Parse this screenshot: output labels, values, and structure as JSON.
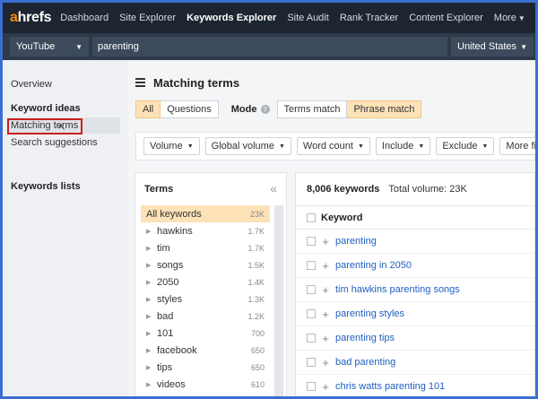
{
  "nav": {
    "logo_a": "a",
    "logo_rest": "hrefs",
    "items": [
      {
        "label": "Dashboard"
      },
      {
        "label": "Site Explorer"
      },
      {
        "label": "Keywords Explorer"
      },
      {
        "label": "Site Audit"
      },
      {
        "label": "Rank Tracker"
      },
      {
        "label": "Content Explorer"
      },
      {
        "label": "More"
      }
    ]
  },
  "search": {
    "source": "YouTube",
    "query": "parenting",
    "country": "United States"
  },
  "sidebar": {
    "overview": "Overview",
    "keyword_ideas": "Keyword ideas",
    "matching_terms": "Matching terms",
    "search_suggestions": "Search suggestions",
    "keywords_lists": "Keywords lists"
  },
  "main": {
    "title": "Matching terms",
    "tab_all": "All",
    "tab_questions": "Questions",
    "mode_label": "Mode",
    "mode_terms": "Terms match",
    "mode_phrase": "Phrase match",
    "filters": [
      "Volume",
      "Global volume",
      "Word count",
      "Include",
      "Exclude",
      "More filte"
    ]
  },
  "terms": {
    "title": "Terms",
    "rows": [
      {
        "label": "All keywords",
        "count": "23K"
      },
      {
        "label": "hawkins",
        "count": "1.7K"
      },
      {
        "label": "tim",
        "count": "1.7K"
      },
      {
        "label": "songs",
        "count": "1.5K"
      },
      {
        "label": "2050",
        "count": "1.4K"
      },
      {
        "label": "styles",
        "count": "1.3K"
      },
      {
        "label": "bad",
        "count": "1.2K"
      },
      {
        "label": "101",
        "count": "700"
      },
      {
        "label": "facebook",
        "count": "650"
      },
      {
        "label": "tips",
        "count": "650"
      },
      {
        "label": "videos",
        "count": "610"
      }
    ]
  },
  "keywords": {
    "count": "8,006 keywords",
    "volume": "Total volume: 23K",
    "column": "Keyword",
    "rows": [
      "parenting",
      "parenting in 2050",
      "tim hawkins parenting songs",
      "parenting styles",
      "parenting tips",
      "bad parenting",
      "chris watts parenting 101"
    ]
  },
  "colors": {
    "nav_bg": "#1c2530",
    "accent_orange": "#ff8800",
    "highlight": "#fde2b8",
    "link": "#1f5fbf",
    "annotation_red": "#cc1f1f"
  }
}
